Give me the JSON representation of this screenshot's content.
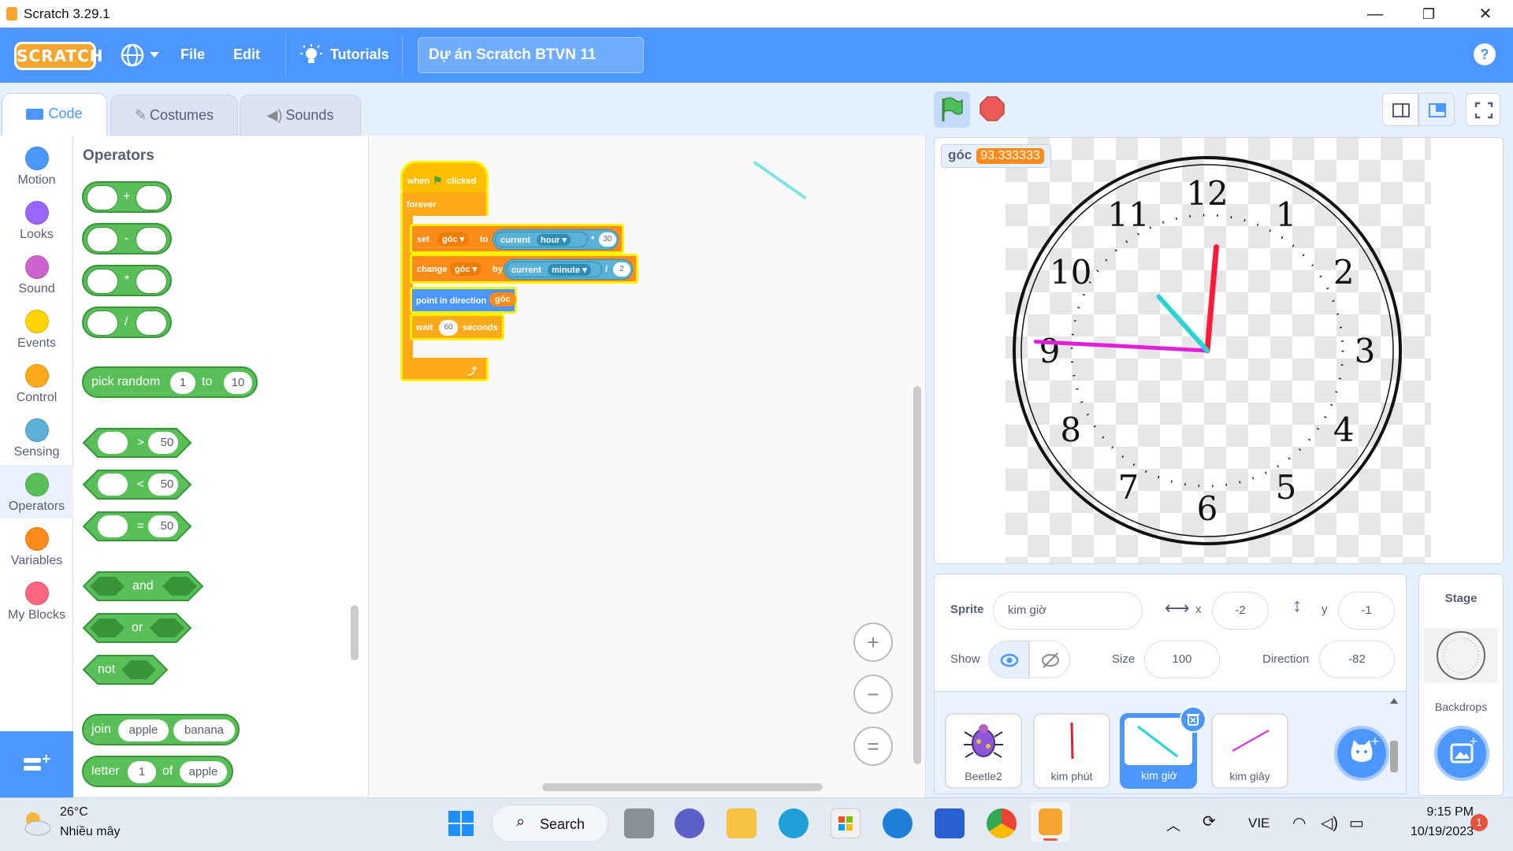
{
  "window": {
    "title": "Scratch 3.29.1",
    "min": "—",
    "max": "❐",
    "close": "✕"
  },
  "menu": {
    "logo": "SCRATCH",
    "file": "File",
    "edit": "Edit",
    "tutorials": "Tutorials",
    "project_title": "Dự án Scratch BTVN 11",
    "help": "?"
  },
  "tabs": {
    "code": "Code",
    "costumes": "Costumes",
    "sounds": "Sounds"
  },
  "categories": [
    {
      "label": "Motion",
      "color": "#4c97ff"
    },
    {
      "label": "Looks",
      "color": "#9966ff"
    },
    {
      "label": "Sound",
      "color": "#cf63cf"
    },
    {
      "label": "Events",
      "color": "#ffd500"
    },
    {
      "label": "Control",
      "color": "#ffab19"
    },
    {
      "label": "Sensing",
      "color": "#5cb1d6"
    },
    {
      "label": "Operators",
      "color": "#59c059"
    },
    {
      "label": "Variables",
      "color": "#ff8c1a"
    },
    {
      "label": "My Blocks",
      "color": "#ff6680"
    }
  ],
  "palette": {
    "title": "Operators",
    "add": "+",
    "sub": "-",
    "mul": "*",
    "div": "/",
    "random": {
      "label": "pick random",
      "from": "1",
      "to_label": "to",
      "to": "10"
    },
    "gt": {
      "op": ">",
      "val": "50"
    },
    "lt": {
      "op": "<",
      "val": "50"
    },
    "eq": {
      "op": "=",
      "val": "50"
    },
    "and": "and",
    "or": "or",
    "not": "not",
    "join": {
      "label": "join",
      "a": "apple",
      "b": "banana"
    },
    "letter": {
      "label": "letter",
      "n": "1",
      "of": "of",
      "s": "apple"
    }
  },
  "script": {
    "when": "when",
    "clicked": "clicked",
    "forever": "forever",
    "set": "set",
    "var": "góc",
    "to": "to",
    "current": "current",
    "hour": "hour",
    "times": "*",
    "thirty": "30",
    "change": "change",
    "by": "by",
    "minute": "minute",
    "divide": "/",
    "two": "2",
    "point": "point in direction",
    "wait": "wait",
    "sixty": "60",
    "seconds": "seconds"
  },
  "zoom": {
    "in": "+",
    "out": "−",
    "reset": "="
  },
  "stage": {
    "monitor_label": "góc",
    "monitor_value": "93.333333",
    "clock_numbers": [
      "12",
      "1",
      "2",
      "3",
      "4",
      "5",
      "6",
      "7",
      "8",
      "9",
      "10",
      "11"
    ],
    "hour_hand_angle_deg": -82,
    "hand_colors": {
      "hour": "#2ad4d4",
      "minute": "#ff1a3c",
      "second": "#e020d8"
    }
  },
  "sprite_info": {
    "sprite_label": "Sprite",
    "name": "kim giờ",
    "x_label": "x",
    "x": "-2",
    "y_label": "y",
    "y": "-1",
    "show_label": "Show",
    "size_label": "Size",
    "size": "100",
    "direction_label": "Direction",
    "direction": "-82"
  },
  "sprites": [
    {
      "name": "Beetle2"
    },
    {
      "name": "kim phút"
    },
    {
      "name": "kim giờ"
    },
    {
      "name": "kim giây"
    }
  ],
  "stage_panel": {
    "title": "Stage",
    "backdrops": "Backdrops"
  },
  "taskbar": {
    "temp": "26°C",
    "weather": "Nhiều mây",
    "search": "Search",
    "lang": "VIE",
    "time": "9:15 PM",
    "date": "10/19/2023",
    "notif": "1"
  }
}
